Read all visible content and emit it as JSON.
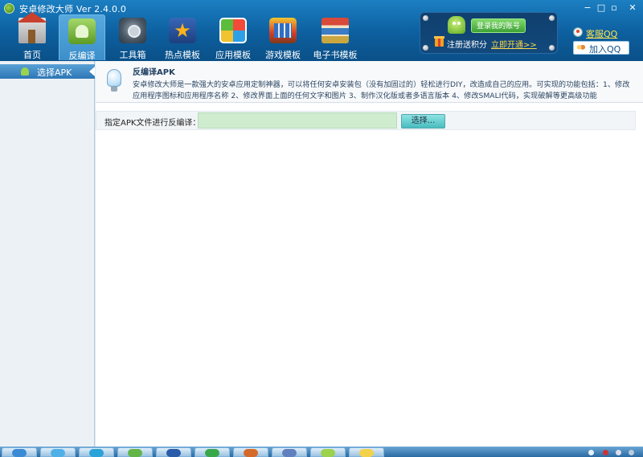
{
  "window": {
    "title": "安卓修改大师 Ver 2.4.0.0",
    "controls": {
      "minimize": "−",
      "maximize": "□",
      "restore": "▫",
      "close": "✕"
    }
  },
  "nav": {
    "tabs": [
      {
        "label": "首页",
        "icon": "home-icon",
        "active": false
      },
      {
        "label": "反编译",
        "icon": "android-icon",
        "active": true
      },
      {
        "label": "工具箱",
        "icon": "toolbox-icon",
        "active": false
      },
      {
        "label": "热点模板",
        "icon": "star-icon",
        "active": false
      },
      {
        "label": "应用模板",
        "icon": "app-grid-icon",
        "active": false
      },
      {
        "label": "游戏模板",
        "icon": "game-icon",
        "active": false
      },
      {
        "label": "电子书模板",
        "icon": "books-icon",
        "active": false
      }
    ]
  },
  "login": {
    "button_label": "登录我的账号",
    "register_text": "注册送积分",
    "activate_link": "立即开通>>"
  },
  "support": {
    "cs_link": "客服QQ",
    "qq_group": "加入QQ群"
  },
  "sidebar": {
    "items": [
      {
        "label": "选择APK",
        "icon": "android-icon",
        "selected": true
      }
    ]
  },
  "main": {
    "info_title": "反编译APK",
    "info_description": "安卓修改大师是一款强大的安卓应用定制神器，可以将任何安卓安装包（没有加固过的）轻松进行DIY，改造成自己的应用。可实现的功能包括：1、修改应用程序图标和应用程序名称 2、修改界面上面的任何文字和图片 3、制作汉化版或者多语言版本 4、修改SMALI代码，实现破解等更高级功能",
    "apk_label": "指定APK文件进行反编译：",
    "apk_path_value": "",
    "select_button": "选择..."
  },
  "colors": {
    "header_top": "#1b7fc2",
    "header_bottom": "#0a5088",
    "accent_link": "#ffd84a",
    "input_bg": "#cfeccf",
    "select_button": "#49bcbf"
  }
}
